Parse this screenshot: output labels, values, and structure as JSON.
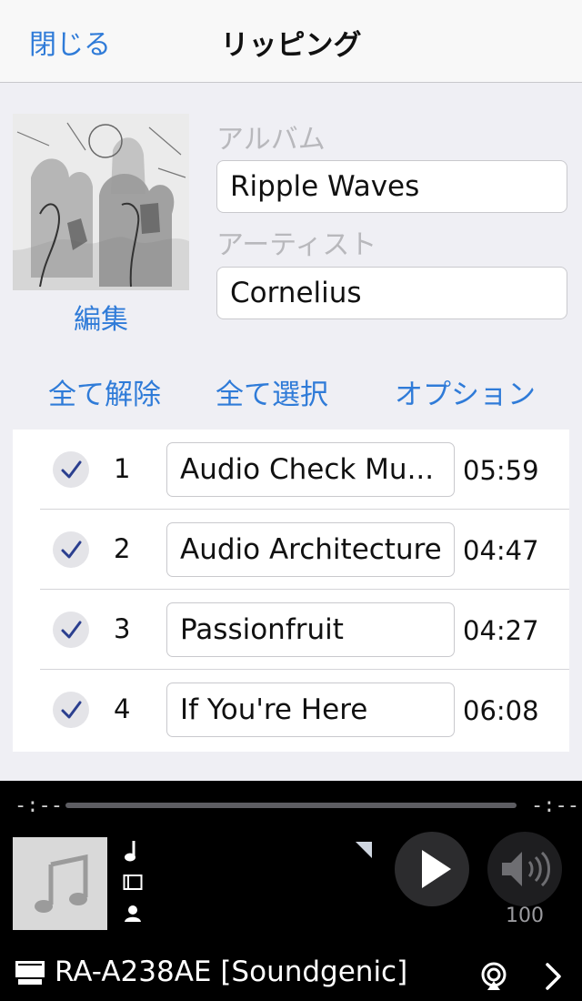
{
  "nav": {
    "close_label": "閉じる",
    "title": "リッピング"
  },
  "album": {
    "edit_label": "編集",
    "album_label": "アルバム",
    "album_value": "Ripple Waves",
    "artist_label": "アーティスト",
    "artist_value": "Cornelius"
  },
  "actions": {
    "deselect_all": "全て解除",
    "select_all": "全て選択",
    "options": "オプション"
  },
  "tracks": [
    {
      "number": "1",
      "title": "Audio Check Mu...",
      "duration": "05:59",
      "checked": true
    },
    {
      "number": "2",
      "title": "Audio Architecture",
      "duration": "04:47",
      "checked": true
    },
    {
      "number": "3",
      "title": "Passionfruit",
      "duration": "04:27",
      "checked": true
    },
    {
      "number": "4",
      "title": "If You're Here",
      "duration": "06:08",
      "checked": true
    }
  ],
  "player": {
    "elapsed": "-:--",
    "remaining": "-:--",
    "volume": "100",
    "device_name": "RA-A238AE [Soundgenic]",
    "icons": [
      "music-note-icon",
      "album-icon",
      "artist-icon",
      "play-icon",
      "volume-icon",
      "airplay-icon",
      "chevron-right-icon",
      "device-icon"
    ]
  },
  "colors": {
    "accent": "#2f7bd8",
    "check": "#2b3f8f",
    "player_bg": "#000000"
  }
}
